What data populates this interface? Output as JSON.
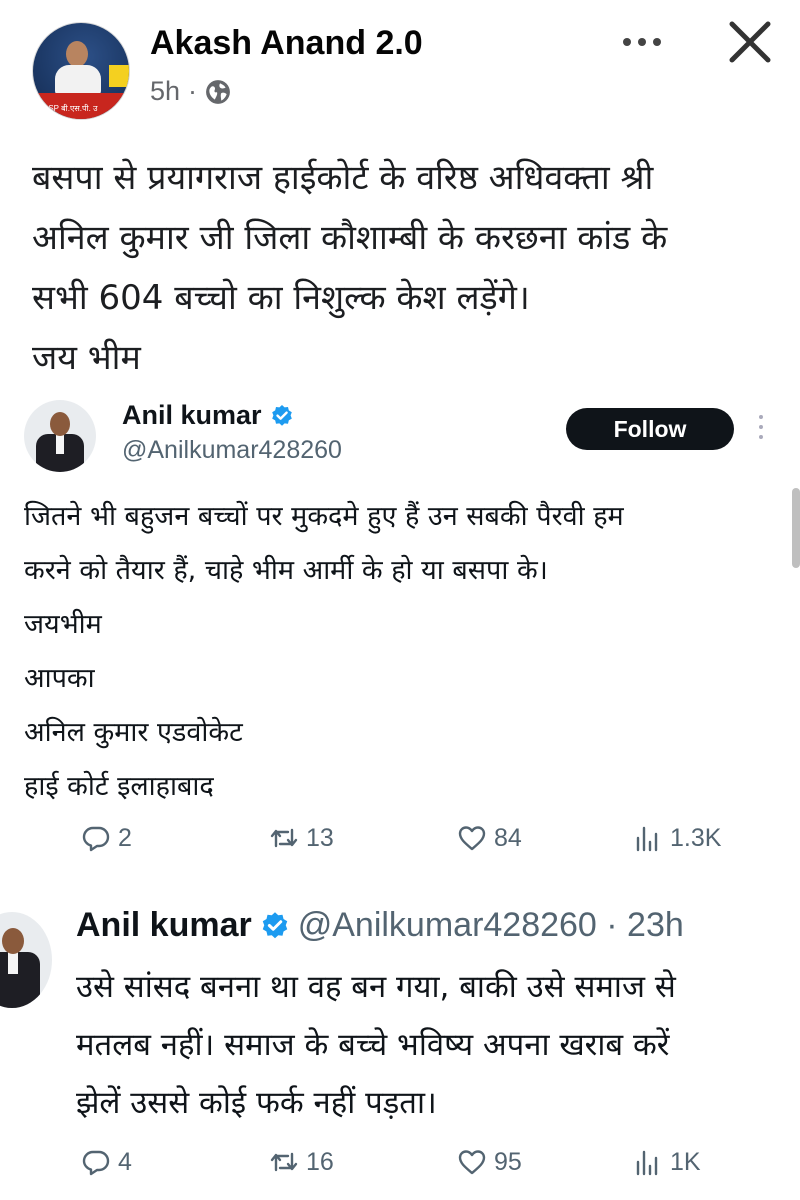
{
  "post": {
    "author": "Akash Anand 2.0",
    "time": "5h",
    "separator": "·",
    "privacy_icon": "globe-icon",
    "avatar_text": "BSP बी.एस.पी. उ",
    "lines": [
      "बसपा से प्रयागराज हाईकोर्ट के वरिष्ठ अधिवक्ता श्री",
      "अनिल कुमार जी  जिला कौशाम्बी के करछना कांड के",
      "सभी 604 बच्चो का निशुल्क केश लड़ेंगे।",
      "जय भीम"
    ]
  },
  "tweet1": {
    "name": "Anil kumar",
    "handle": "@Anilkumar428260",
    "follow_label": "Follow",
    "lines": [
      "जितने भी बहुजन बच्चों पर मुकदमे हुए हैं उन सबकी पैरवी हम",
      "करने को तैयार हैं, चाहे भीम आर्मी के हो या बसपा के।",
      "जयभीम",
      "आपका",
      "अनिल कुमार एडवोकेट",
      "हाई कोर्ट इलाहाबाद"
    ],
    "replies": "2",
    "retweets": "13",
    "likes": "84",
    "views": "1.3K"
  },
  "tweet2": {
    "name": "Anil kumar",
    "handle_time": "@Anilkumar428260 · 23h",
    "lines": [
      "उसे सांसद बनना था वह बन गया, बाकी उसे समाज से",
      "मतलब नहीं। समाज के बच्चे भविष्य अपना खराब करें",
      "झेलें उससे कोई फर्क नहीं पड़ता।"
    ],
    "replies": "4",
    "retweets": "16",
    "likes": "95",
    "views": "1K"
  },
  "colors": {
    "text": "#0f1419",
    "secondary": "#536471",
    "verified": "#1d9bf0",
    "follow_bg": "#0f1419"
  }
}
